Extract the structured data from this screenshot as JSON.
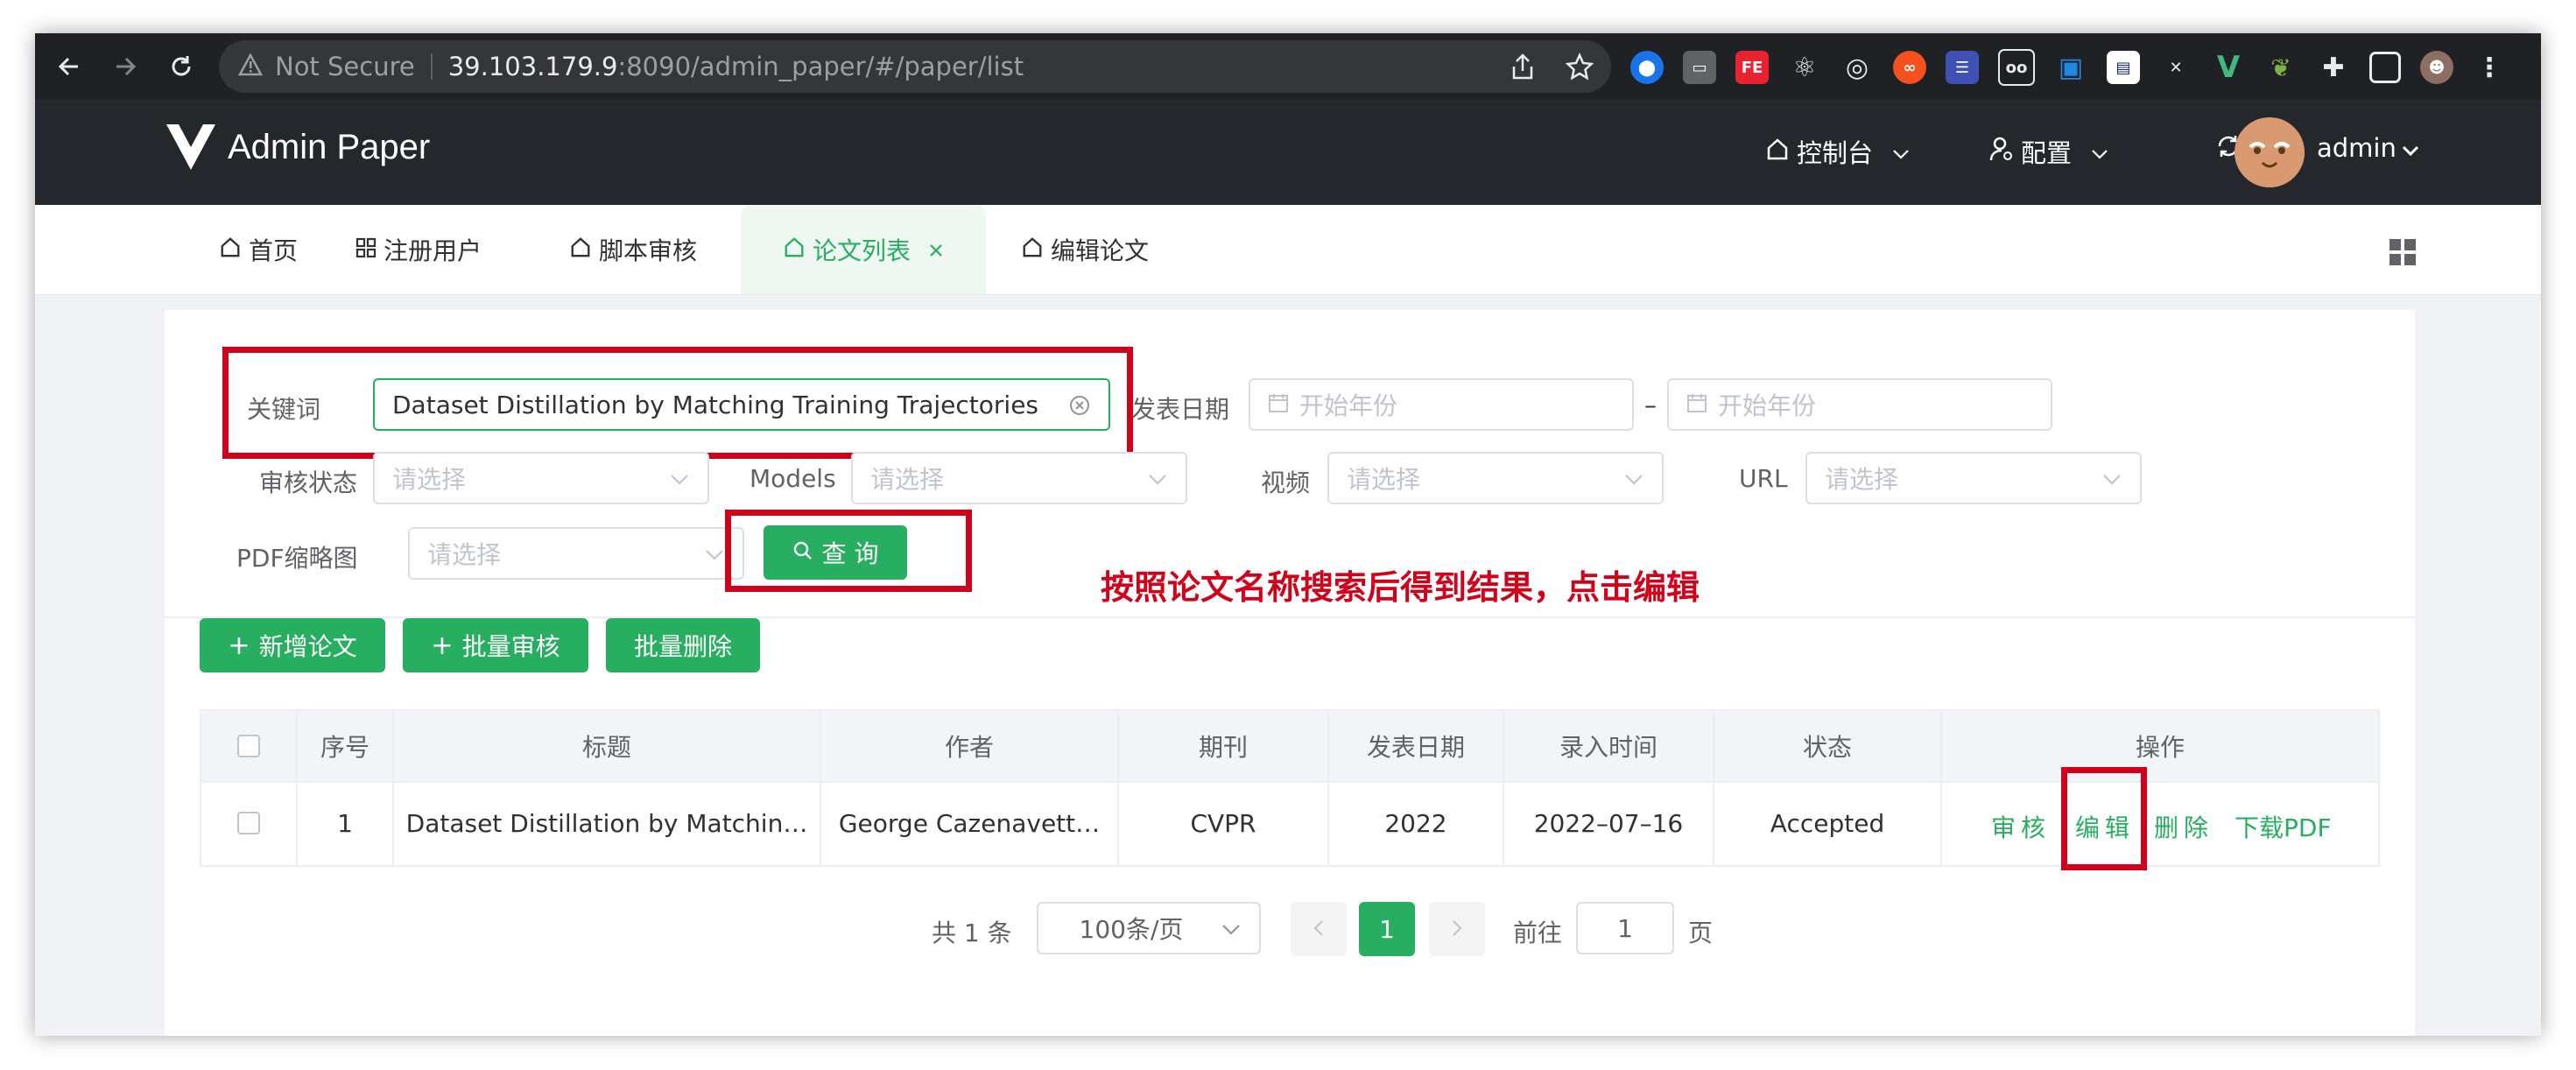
{
  "browser": {
    "security_label": "Not Secure",
    "url_host": "39.103.179.9",
    "url_path": ":8090/admin_paper/#/paper/list"
  },
  "app": {
    "title": "Admin Paper",
    "nav_console": "控制台",
    "nav_config": "配置",
    "user_name": "admin"
  },
  "tabs": [
    {
      "label": "首页"
    },
    {
      "label": "注册用户"
    },
    {
      "label": "脚本审核"
    },
    {
      "label": "论文列表"
    },
    {
      "label": "编辑论文"
    }
  ],
  "filters": {
    "keyword_label": "关键词",
    "keyword_value": "Dataset Distillation by Matching Training Trajectories",
    "date_label": "发表日期",
    "date_start_placeholder": "开始年份",
    "date_sep": "–",
    "date_end_placeholder": "开始年份",
    "review_status_label": "审核状态",
    "models_label": "Models",
    "video_label": "视频",
    "url_label": "URL",
    "pdf_thumb_label": "PDF缩略图",
    "select_placeholder": "请选择",
    "search_button": "查 询"
  },
  "annotation": "按照论文名称搜索后得到结果，点击编辑",
  "actions": {
    "add": "新增论文",
    "batch_review": "批量审核",
    "batch_delete": "批量删除"
  },
  "table": {
    "headers": [
      "序号",
      "标题",
      "作者",
      "期刊",
      "发表日期",
      "录入时间",
      "状态",
      "操作"
    ],
    "rows": [
      {
        "index": "1",
        "title": "Dataset Distillation by Matchin…",
        "author": "George Cazenavett…",
        "journal": "CVPR",
        "pub_date": "2022",
        "entry_time": "2022–07–16",
        "status": "Accepted"
      }
    ],
    "ops": {
      "review": "审核",
      "edit": "编辑",
      "delete": "删除",
      "download": "下载PDF"
    }
  },
  "pagination": {
    "total": "共 1 条",
    "page_size": "100条/页",
    "current_page": "1",
    "goto_label": "前往",
    "goto_value": "1",
    "page_suffix": "页"
  },
  "colors": {
    "accent": "#27ae60",
    "header_bg": "#24272b",
    "annotation_red": "#d0021b"
  }
}
